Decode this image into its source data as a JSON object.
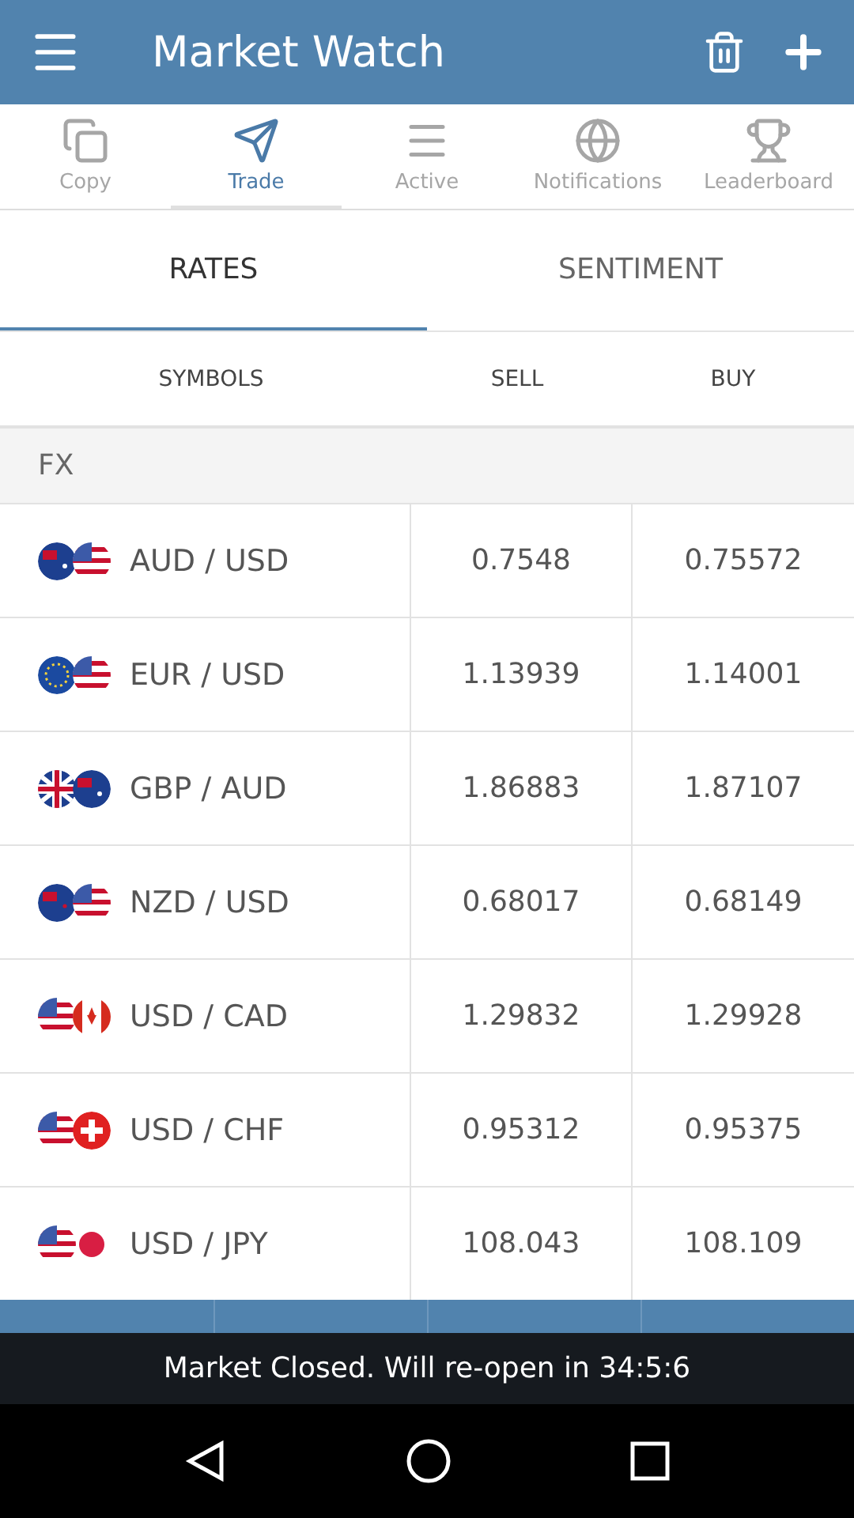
{
  "app_bar": {
    "title": "Market Watch"
  },
  "nav_tabs": [
    {
      "label": "Copy",
      "selected": false
    },
    {
      "label": "Trade",
      "selected": true
    },
    {
      "label": "Active",
      "selected": false
    },
    {
      "label": "Notifications",
      "selected": false
    },
    {
      "label": "Leaderboard",
      "selected": false
    }
  ],
  "view_tabs": [
    {
      "label": "RATES",
      "selected": true
    },
    {
      "label": "SENTIMENT",
      "selected": false
    }
  ],
  "table": {
    "columns": [
      "SYMBOLS",
      "SELL",
      "BUY"
    ],
    "section": "FX",
    "rows": [
      {
        "symbol": "AUD / USD",
        "flags": [
          {
            "kind": "au"
          },
          {
            "kind": "us"
          }
        ],
        "sell": "0.7548",
        "buy": "0.75572"
      },
      {
        "symbol": "EUR / USD",
        "flags": [
          {
            "kind": "eu"
          },
          {
            "kind": "us"
          }
        ],
        "sell": "1.13939",
        "buy": "1.14001"
      },
      {
        "symbol": "GBP / AUD",
        "flags": [
          {
            "kind": "gb"
          },
          {
            "kind": "au"
          }
        ],
        "sell": "1.86883",
        "buy": "1.87107"
      },
      {
        "symbol": "NZD / USD",
        "flags": [
          {
            "kind": "nz"
          },
          {
            "kind": "us"
          }
        ],
        "sell": "0.68017",
        "buy": "0.68149"
      },
      {
        "symbol": "USD / CAD",
        "flags": [
          {
            "kind": "us"
          },
          {
            "kind": "ca"
          }
        ],
        "sell": "1.29832",
        "buy": "1.29928"
      },
      {
        "symbol": "USD / CHF",
        "flags": [
          {
            "kind": "us"
          },
          {
            "kind": "ch"
          }
        ],
        "sell": "0.95312",
        "buy": "0.95375"
      },
      {
        "symbol": "USD / JPY",
        "flags": [
          {
            "kind": "us"
          },
          {
            "kind": "jp"
          }
        ],
        "sell": "108.043",
        "buy": "108.109"
      }
    ]
  },
  "toast": "Market Closed. Will re-open in 34:5:6"
}
